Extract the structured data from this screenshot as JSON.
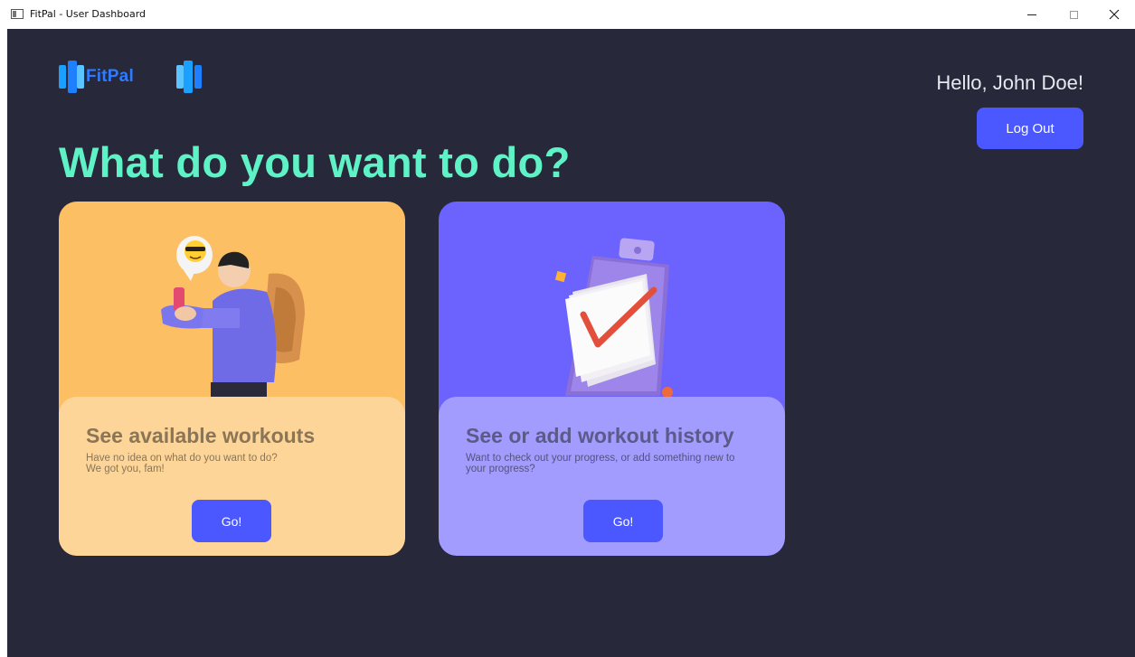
{
  "window": {
    "title": "FitPal - User Dashboard"
  },
  "header": {
    "brand": "FitPal",
    "greeting": "Hello, John Doe!",
    "logout_label": "Log Out"
  },
  "main": {
    "headline": "What do you want to do?",
    "cards": [
      {
        "title": "See available workouts",
        "description": "Have no idea on what do you want to do?\nWe got you, fam!",
        "button_label": "Go!"
      },
      {
        "title": "See or add workout history",
        "description": "Want to check out your progress, or add something new to your progress?",
        "button_label": "Go!"
      }
    ]
  },
  "colors": {
    "background": "#272839",
    "accent": "#5ff2c6",
    "button": "#4b57ff",
    "card_workouts": "#fdbf63",
    "card_history": "#6c63ff"
  }
}
